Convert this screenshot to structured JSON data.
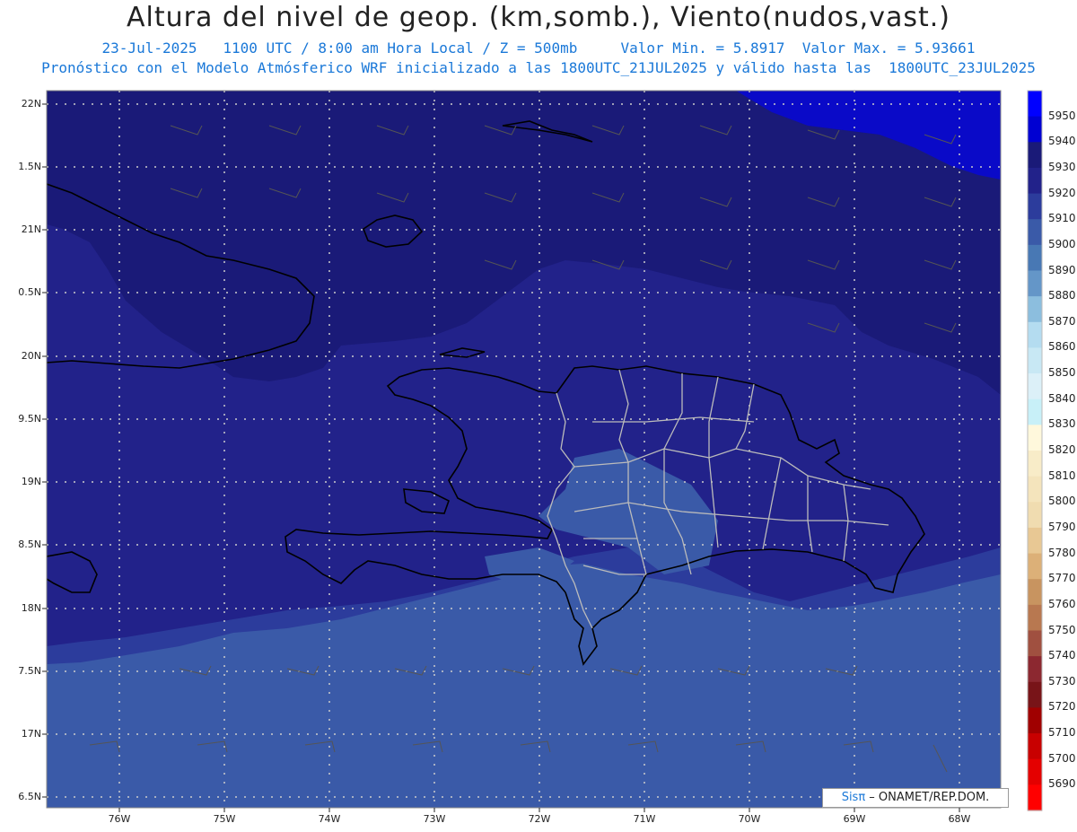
{
  "header": {
    "title": "Altura del nivel de geop. (km,somb.), Viento(nudos,vast.)",
    "line1": "23-Jul-2025   1100 UTC / 8:00 am Hora Local / Z = 500mb     Valor Min. = 5.8917  Valor Max. = 5.93661",
    "line2": "Pronóstico con el Modelo Atmósferico WRF inicializado a las 1800UTC_21JUL2025 y válido hasta las  1800UTC_23JUL2025"
  },
  "map": {
    "lat_labels": [
      "22N",
      "1.5N",
      "21N",
      "0.5N",
      "20N",
      "9.5N",
      "19N",
      "8.5N",
      "18N",
      "7.5N",
      "17N",
      "6.5N"
    ],
    "lon_labels": [
      "76W",
      "75W",
      "74W",
      "73W",
      "72W",
      "71W",
      "70W",
      "69W",
      "68W"
    ],
    "fill_colors": {
      "c5930": "#1a1a78",
      "c5920": "#22228a",
      "c5910": "#2c3c9c",
      "c5900": "#3a5aa8",
      "c5940": "#0a0ac8",
      "coast": "#000000",
      "border": "#bbbbbb"
    }
  },
  "colorbar": {
    "levels": [
      "5950",
      "5940",
      "5930",
      "5920",
      "5910",
      "5900",
      "5890",
      "5880",
      "5870",
      "5860",
      "5850",
      "5840",
      "5830",
      "5820",
      "5810",
      "5800",
      "5790",
      "5780",
      "5770",
      "5760",
      "5750",
      "5740",
      "5730",
      "5720",
      "5710",
      "5700",
      "5690"
    ],
    "colors": [
      "#0000ff",
      "#0000d2",
      "#1a1a78",
      "#22228a",
      "#2c3c9c",
      "#3a5aa8",
      "#4878b4",
      "#6496c8",
      "#8cbede",
      "#b4dcf0",
      "#c8e8f4",
      "#dcf0f8",
      "#c8f0f8",
      "#fff8dc",
      "#f8ecc8",
      "#f4e4bc",
      "#f0dcb0",
      "#e8c894",
      "#dcb078",
      "#c89460",
      "#b87850",
      "#a05040",
      "#8c2830",
      "#781418",
      "#a00000",
      "#c80000",
      "#e40000",
      "#ff0000"
    ]
  },
  "credit": {
    "brand": "Sisπ",
    "text": " – ONAMET/REP.DOM."
  }
}
